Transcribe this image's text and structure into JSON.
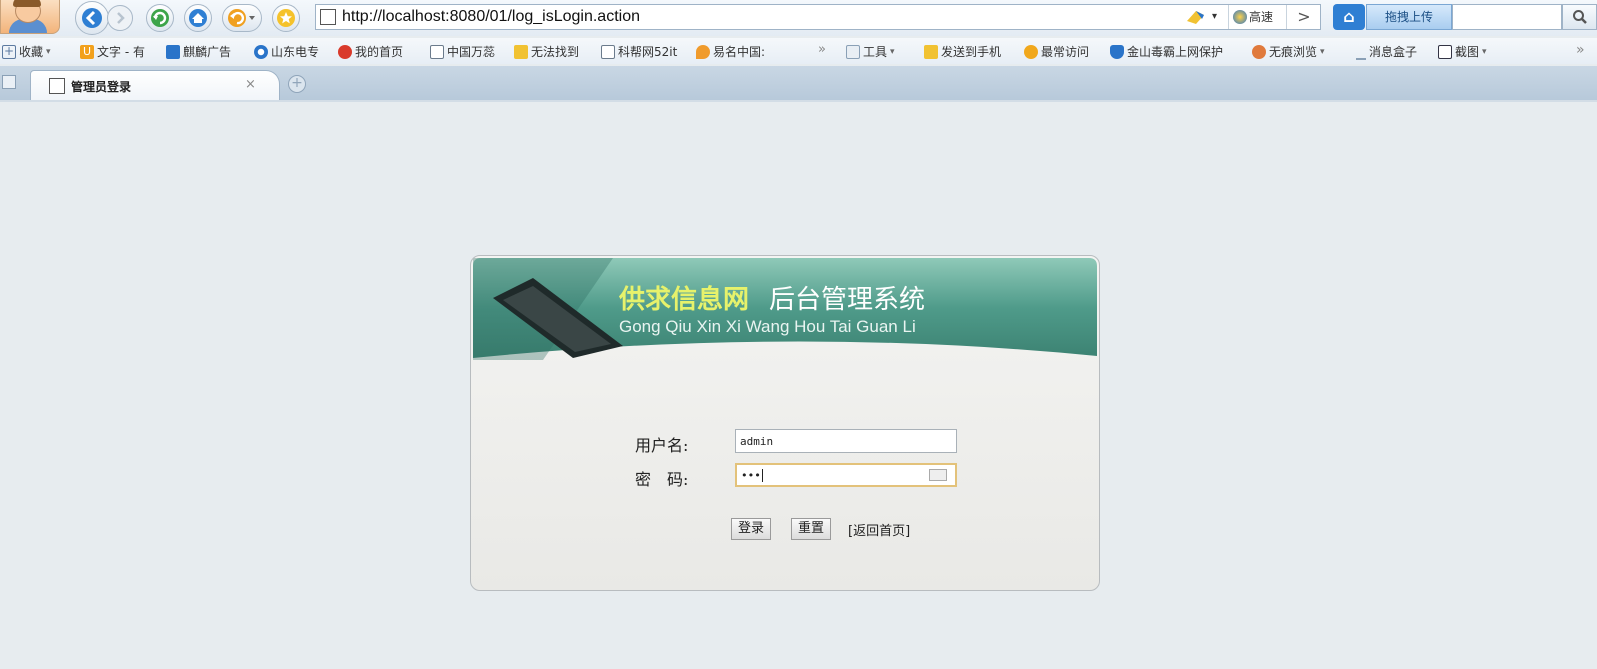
{
  "browser": {
    "url": "http://localhost:8080/01/log_isLogin.action",
    "speed_label": "高速",
    "upload_label": "拖拽上传"
  },
  "bookmarks": {
    "left": [
      {
        "label": "收藏",
        "icon": "plus-icon",
        "color": "#5c7aa0"
      },
      {
        "label": "文字 - 有",
        "icon": "u-icon",
        "color": "#f2a11c"
      },
      {
        "label": "麒麟广告",
        "icon": "ad-icon",
        "color": "#2a74c9"
      },
      {
        "label": "山东电专",
        "icon": "swirl-icon",
        "color": "#2a74c9"
      },
      {
        "label": "我的首页",
        "icon": "weibo-icon",
        "color": "#d93a2b"
      },
      {
        "label": "中国万蕊",
        "icon": "page-icon",
        "color": "#6b7b8c"
      },
      {
        "label": "无法找到",
        "icon": "folder-icon",
        "color": "#f1c232"
      },
      {
        "label": "科帮网52it",
        "icon": "page-icon",
        "color": "#6b7b8c"
      },
      {
        "label": "易名中国:",
        "icon": "flame-icon",
        "color": "#f09b2c"
      }
    ],
    "right": [
      {
        "label": "工具",
        "icon": "toolbox-icon",
        "color": "#8aa0b6"
      },
      {
        "label": "发送到手机",
        "icon": "send-icon",
        "color": "#f1c232"
      },
      {
        "label": "最常访问",
        "icon": "clock-icon",
        "color": "#f1a81c"
      },
      {
        "label": "金山毒霸上网保护",
        "icon": "shield-icon",
        "color": "#2a74c9"
      },
      {
        "label": "无痕浏览",
        "icon": "mask-icon",
        "color": "#e07a3c"
      },
      {
        "label": "消息盒子",
        "icon": "message-icon",
        "color": "#8aa0b6"
      },
      {
        "label": "截图",
        "icon": "scissors-icon",
        "color": "#334"
      }
    ]
  },
  "tab": {
    "title": "管理员登录",
    "close": "×",
    "new_tab": "+"
  },
  "banner": {
    "title_highlight": "供求信息网",
    "title_rest": "后台管理系统",
    "subtitle": "Gong Qiu Xin Xi Wang Hou Tai Guan Li"
  },
  "login": {
    "username_label": "用户名:",
    "password_label": "密　码:",
    "username_value": "admin",
    "password_value": "•••",
    "login_button": "登录",
    "reset_button": "重置",
    "back_link": "[返回首页]"
  }
}
